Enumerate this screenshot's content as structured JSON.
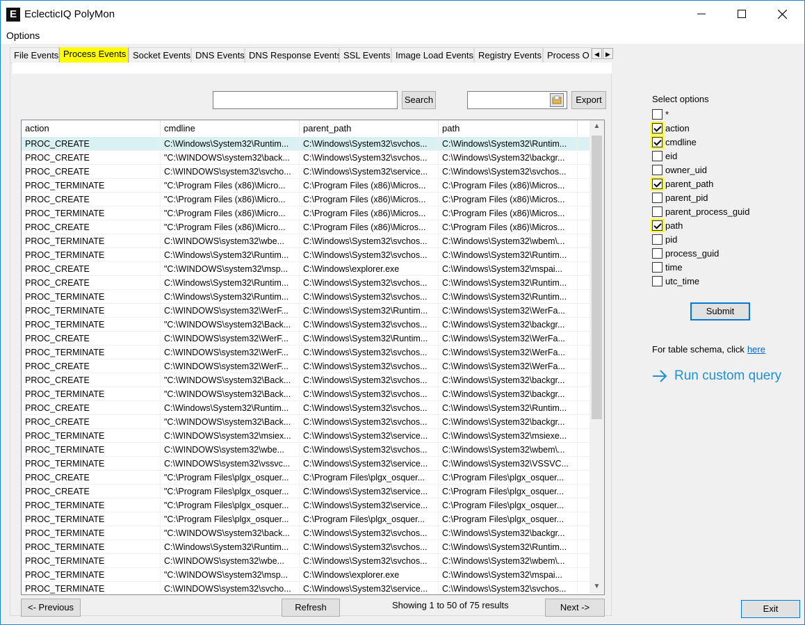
{
  "window": {
    "title": "EclecticIQ PolyMon",
    "icon_letter": "E",
    "icons": [
      "minimize-icon",
      "maximize-icon",
      "close-icon"
    ]
  },
  "menu": {
    "options": "Options"
  },
  "tabs": [
    {
      "label": "File Events",
      "active": false
    },
    {
      "label": "Process Events",
      "active": true
    },
    {
      "label": "Socket Events",
      "active": false
    },
    {
      "label": "DNS Events",
      "active": false
    },
    {
      "label": "DNS Response Events",
      "active": false
    },
    {
      "label": "SSL Events",
      "active": false
    },
    {
      "label": "Image Load Events",
      "active": false
    },
    {
      "label": "Registry Events",
      "active": false
    },
    {
      "label": "Process O",
      "active": false
    }
  ],
  "toolbar": {
    "search_value": "",
    "search_label": "Search",
    "export_path": "",
    "export_label": "Export"
  },
  "table": {
    "columns": [
      "action",
      "cmdline",
      "parent_path",
      "path"
    ],
    "rows": [
      [
        "PROC_CREATE",
        "C:\\Windows\\System32\\Runtim...",
        "C:\\Windows\\System32\\svchos...",
        "C:\\Windows\\System32\\Runtim..."
      ],
      [
        "PROC_CREATE",
        "\"C:\\WINDOWS\\system32\\back...",
        "C:\\Windows\\System32\\svchos...",
        "C:\\Windows\\System32\\backgr..."
      ],
      [
        "PROC_CREATE",
        "C:\\WINDOWS\\system32\\svcho...",
        "C:\\Windows\\System32\\service...",
        "C:\\Windows\\System32\\svchos..."
      ],
      [
        "PROC_TERMINATE",
        "\"C:\\Program Files (x86)\\Micro...",
        "C:\\Program Files (x86)\\Micros...",
        "C:\\Program Files (x86)\\Micros..."
      ],
      [
        "PROC_CREATE",
        "\"C:\\Program Files (x86)\\Micro...",
        "C:\\Program Files (x86)\\Micros...",
        "C:\\Program Files (x86)\\Micros..."
      ],
      [
        "PROC_TERMINATE",
        "\"C:\\Program Files (x86)\\Micro...",
        "C:\\Program Files (x86)\\Micros...",
        "C:\\Program Files (x86)\\Micros..."
      ],
      [
        "PROC_CREATE",
        "\"C:\\Program Files (x86)\\Micro...",
        "C:\\Program Files (x86)\\Micros...",
        "C:\\Program Files (x86)\\Micros..."
      ],
      [
        "PROC_TERMINATE",
        "C:\\WINDOWS\\system32\\wbe...",
        "C:\\Windows\\System32\\svchos...",
        "C:\\Windows\\System32\\wbem\\..."
      ],
      [
        "PROC_TERMINATE",
        "C:\\Windows\\System32\\Runtim...",
        "C:\\Windows\\System32\\svchos...",
        "C:\\Windows\\System32\\Runtim..."
      ],
      [
        "PROC_CREATE",
        "\"C:\\WINDOWS\\system32\\msp...",
        "C:\\Windows\\explorer.exe",
        "C:\\Windows\\System32\\mspai..."
      ],
      [
        "PROC_CREATE",
        "C:\\Windows\\System32\\Runtim...",
        "C:\\Windows\\System32\\svchos...",
        "C:\\Windows\\System32\\Runtim..."
      ],
      [
        "PROC_TERMINATE",
        "C:\\Windows\\System32\\Runtim...",
        "C:\\Windows\\System32\\svchos...",
        "C:\\Windows\\System32\\Runtim..."
      ],
      [
        "PROC_TERMINATE",
        "C:\\WINDOWS\\system32\\WerF...",
        "C:\\Windows\\System32\\Runtim...",
        "C:\\Windows\\System32\\WerFa..."
      ],
      [
        "PROC_TERMINATE",
        "\"C:\\WINDOWS\\system32\\Back...",
        "C:\\Windows\\System32\\svchos...",
        "C:\\Windows\\System32\\backgr..."
      ],
      [
        "PROC_CREATE",
        "C:\\WINDOWS\\system32\\WerF...",
        "C:\\Windows\\System32\\Runtim...",
        "C:\\Windows\\System32\\WerFa..."
      ],
      [
        "PROC_TERMINATE",
        "C:\\WINDOWS\\system32\\WerF...",
        "C:\\Windows\\System32\\svchos...",
        "C:\\Windows\\System32\\WerFa..."
      ],
      [
        "PROC_CREATE",
        "C:\\WINDOWS\\system32\\WerF...",
        "C:\\Windows\\System32\\svchos...",
        "C:\\Windows\\System32\\WerFa..."
      ],
      [
        "PROC_CREATE",
        "\"C:\\WINDOWS\\system32\\Back...",
        "C:\\Windows\\System32\\svchos...",
        "C:\\Windows\\System32\\backgr..."
      ],
      [
        "PROC_TERMINATE",
        "\"C:\\WINDOWS\\system32\\Back...",
        "C:\\Windows\\System32\\svchos...",
        "C:\\Windows\\System32\\backgr..."
      ],
      [
        "PROC_CREATE",
        "C:\\Windows\\System32\\Runtim...",
        "C:\\Windows\\System32\\svchos...",
        "C:\\Windows\\System32\\Runtim..."
      ],
      [
        "PROC_CREATE",
        "\"C:\\WINDOWS\\system32\\Back...",
        "C:\\Windows\\System32\\svchos...",
        "C:\\Windows\\System32\\backgr..."
      ],
      [
        "PROC_TERMINATE",
        "C:\\WINDOWS\\system32\\msiex...",
        "C:\\Windows\\System32\\service...",
        "C:\\Windows\\System32\\msiexe..."
      ],
      [
        "PROC_TERMINATE",
        "C:\\WINDOWS\\system32\\wbe...",
        "C:\\Windows\\System32\\svchos...",
        "C:\\Windows\\System32\\wbem\\..."
      ],
      [
        "PROC_TERMINATE",
        "C:\\WINDOWS\\system32\\vssvc...",
        "C:\\Windows\\System32\\service...",
        "C:\\Windows\\System32\\VSSVC..."
      ],
      [
        "PROC_CREATE",
        "\"C:\\Program Files\\plgx_osquer...",
        "C:\\Program Files\\plgx_osquer...",
        "C:\\Program Files\\plgx_osquer..."
      ],
      [
        "PROC_CREATE",
        "\"C:\\Program Files\\plgx_osquer...",
        "C:\\Windows\\System32\\service...",
        "C:\\Program Files\\plgx_osquer..."
      ],
      [
        "PROC_TERMINATE",
        "\"C:\\Program Files\\plgx_osquer...",
        "C:\\Windows\\System32\\service...",
        "C:\\Program Files\\plgx_osquer..."
      ],
      [
        "PROC_TERMINATE",
        "\"C:\\Program Files\\plgx_osquer...",
        "C:\\Program Files\\plgx_osquer...",
        "C:\\Program Files\\plgx_osquer..."
      ],
      [
        "PROC_TERMINATE",
        "\"C:\\WINDOWS\\system32\\back...",
        "C:\\Windows\\System32\\svchos...",
        "C:\\Windows\\System32\\backgr..."
      ],
      [
        "PROC_TERMINATE",
        "C:\\Windows\\System32\\Runtim...",
        "C:\\Windows\\System32\\svchos...",
        "C:\\Windows\\System32\\Runtim..."
      ],
      [
        "PROC_TERMINATE",
        "C:\\WINDOWS\\system32\\wbe...",
        "C:\\Windows\\System32\\svchos...",
        "C:\\Windows\\System32\\wbem\\..."
      ],
      [
        "PROC_TERMINATE",
        "\"C:\\WINDOWS\\system32\\msp...",
        "C:\\Windows\\explorer.exe",
        "C:\\Windows\\System32\\mspai..."
      ],
      [
        "PROC_TERMINATE",
        "C:\\WINDOWS\\system32\\svcho...",
        "C:\\Windows\\System32\\service...",
        "C:\\Windows\\System32\\svchos..."
      ]
    ]
  },
  "pagination": {
    "previous_label": "<- Previous",
    "refresh_label": "Refresh",
    "status_text": "Showing 1 to 50 of 75 results",
    "next_label": "Next ->"
  },
  "options_panel": {
    "title": "Select options",
    "options": [
      {
        "label": "*",
        "checked": false
      },
      {
        "label": "action",
        "checked": true
      },
      {
        "label": "cmdline",
        "checked": true
      },
      {
        "label": "eid",
        "checked": false
      },
      {
        "label": "owner_uid",
        "checked": false
      },
      {
        "label": "parent_path",
        "checked": true
      },
      {
        "label": "parent_pid",
        "checked": false
      },
      {
        "label": "parent_process_guid",
        "checked": false
      },
      {
        "label": "path",
        "checked": true
      },
      {
        "label": "pid",
        "checked": false
      },
      {
        "label": "process_guid",
        "checked": false
      },
      {
        "label": "time",
        "checked": false
      },
      {
        "label": "utc_time",
        "checked": false
      }
    ],
    "submit_label": "Submit",
    "schema_text": "For table schema, click",
    "schema_link": "here",
    "custom_query_label": "Run custom query"
  },
  "exit_label": "Exit",
  "colors": {
    "highlight": "#ffff00",
    "accent": "#0078d7",
    "link": "#1e90d6",
    "selected_row": "#d9f1f3"
  }
}
